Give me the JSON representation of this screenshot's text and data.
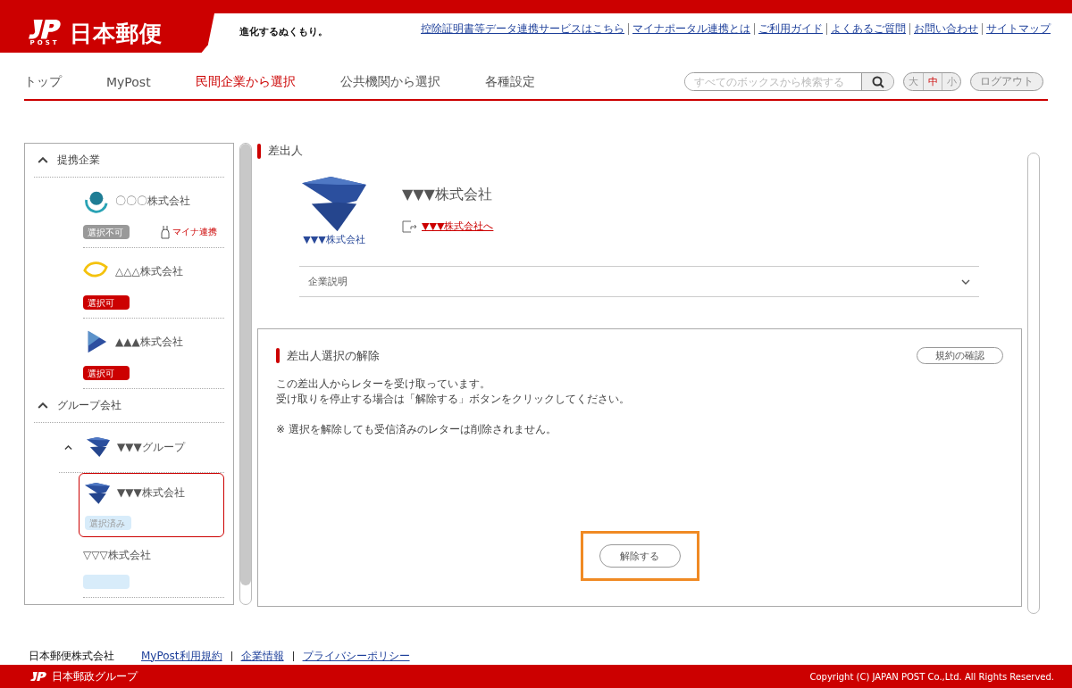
{
  "header": {
    "brand": "日本郵便",
    "logo_sub": "POST",
    "tagline": "進化するぬくもり。",
    "links": [
      "控除証明書等データ連携サービスはこちら",
      "マイナポータル連携とは",
      "ご利用ガイド",
      "よくあるご質問",
      "お問い合わせ",
      "サイトマップ"
    ]
  },
  "nav": {
    "tabs": [
      {
        "label": "トップ",
        "selected": false
      },
      {
        "label": "MyPost",
        "selected": false
      },
      {
        "label": "民間企業から選択",
        "selected": true
      },
      {
        "label": "公共機関から選択",
        "selected": false
      },
      {
        "label": "各種設定",
        "selected": false
      }
    ],
    "search": {
      "placeholder": "すべてのボックスから検索する"
    },
    "font_sizes": [
      {
        "label": "大",
        "selected": false
      },
      {
        "label": "中",
        "selected": true
      },
      {
        "label": "小",
        "selected": false
      }
    ],
    "logout": "ログアウト"
  },
  "sidebar": {
    "groups": [
      {
        "label": "提携企業",
        "expanded": true,
        "children": [
          {
            "name": "〇〇〇株式会社",
            "kind": "ring",
            "badge": {
              "text": "選択不可",
              "kind": "unavailable"
            },
            "mina": "マイナ連携",
            "selected": false
          },
          {
            "name": "△△△株式会社",
            "kind": "lens",
            "badge": {
              "text": "選択可",
              "kind": "available"
            },
            "selected": false
          },
          {
            "name": "▲▲▲株式会社",
            "kind": "play",
            "badge": {
              "text": "選択可",
              "kind": "available"
            },
            "selected": false
          }
        ]
      },
      {
        "label": "グループ会社",
        "expanded": true,
        "children": [
          {
            "name": "▼▼▼グループ",
            "kind": "funnel",
            "expanded": true,
            "children": [
              {
                "name": "▼▼▼株式会社",
                "kind": "funnel",
                "badge": {
                  "text": "選択済み",
                  "kind": "chosen"
                },
                "selected": true
              },
              {
                "name": "▽▽▽株式会社",
                "badge": {
                  "kind": "chosen"
                },
                "selected": false
              }
            ]
          }
        ]
      }
    ]
  },
  "sender": {
    "heading": "差出人",
    "logo_caption": "▼▼▼株式会社",
    "name": "▼▼▼株式会社",
    "link": "▼▼▼株式会社へ",
    "accordion": {
      "label": "企業説明",
      "expanded": false
    }
  },
  "release": {
    "heading": "差出人選択の解除",
    "terms_button": "規約の確認",
    "lines": [
      "この差出人からレターを受け取っています。",
      "受け取りを停止する場合は「解除する」ボタンをクリックしてください。"
    ],
    "note": "※ 選択を解除しても受信済みのレターは削除されません。",
    "button": "解除する",
    "button_highlighted": true
  },
  "footer": {
    "company": "日本郵便株式会社",
    "links": [
      "MyPost利用規約",
      "企業情報",
      "プライバシーポリシー"
    ],
    "group": "日本郵政グループ",
    "copyright": "Copyright (C) JAPAN POST Co.,Ltd. All Rights Reserved."
  }
}
